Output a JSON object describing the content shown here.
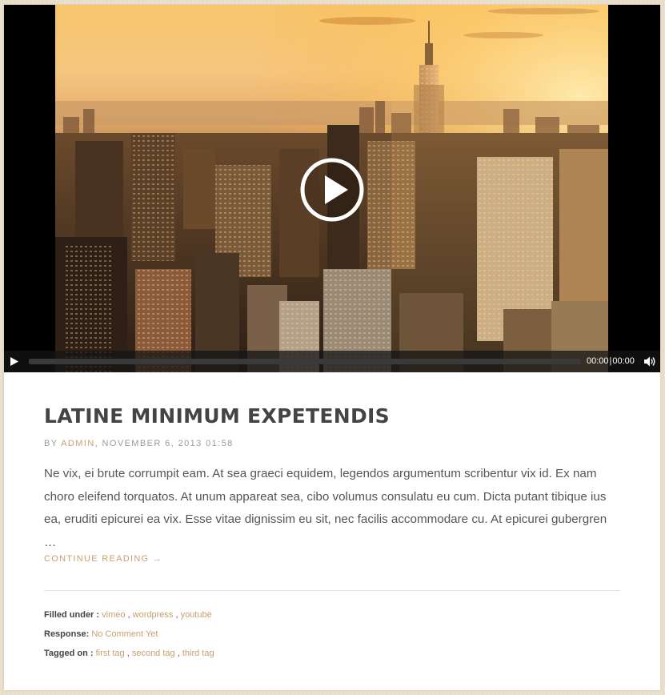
{
  "video": {
    "time_current": "00:00",
    "time_separator": "|",
    "time_total": "00:00",
    "icons": {
      "big_play": "play-circle-icon",
      "play": "play-icon",
      "volume": "volume-icon"
    }
  },
  "post": {
    "title": "LATINE MINIMUM EXPETENDIS",
    "meta": {
      "by_label": "BY",
      "author": "ADMIN",
      "separator": ",",
      "date": "NOVEMBER 6, 2013 01:58"
    },
    "excerpt_lines": [
      "Ne vix, ei brute corrumpit eam. At sea graeci equidem, legendos argumentum scribentur vix id. Ex nam",
      "choro eleifend torquatos. At unum appareat sea, cibo volumus consulatu eu cum. Dicta putant tibique ius",
      "ea, eruditi epicurei ea vix. Esse vitae dignissim eu sit, nec facilis accommodare cu. At epicurei gubergren …"
    ],
    "continue_reading": "CONTINUE READING →",
    "filed_under_label": "Filled under :",
    "categories": [
      "vimeo",
      "wordpress",
      "youtube"
    ],
    "response_label": "Response:",
    "response_value": "No Comment Yet",
    "tagged_label": "Tagged on :",
    "tags": [
      "first tag",
      "second tag",
      "third tag"
    ]
  },
  "colors": {
    "accent": "#c8a070",
    "title": "#444444",
    "body_text": "#555555",
    "meta_text": "#999999",
    "page_background": "#eadfcb"
  }
}
